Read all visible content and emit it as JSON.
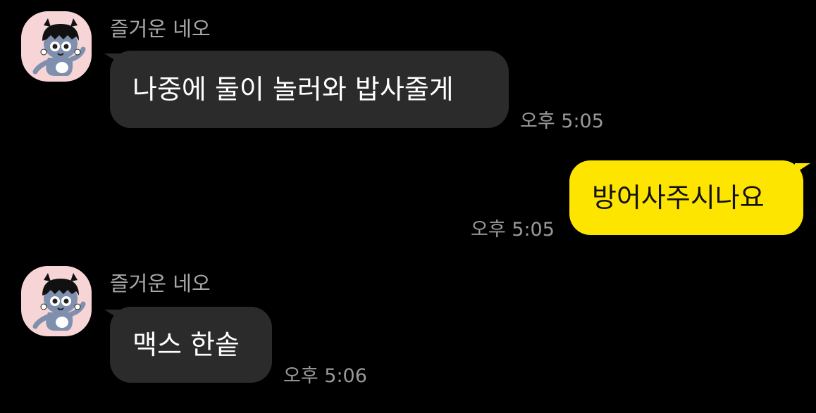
{
  "chat": {
    "messages": [
      {
        "sender": "즐거운 네오",
        "text": "나중에 둘이 놀러와 밥사줄게",
        "time": "오후 5:05",
        "direction": "incoming"
      },
      {
        "text": "방어사주시나요",
        "time": "오후 5:05",
        "direction": "outgoing"
      },
      {
        "sender": "즐거운 네오",
        "text": "맥스 한솥",
        "time": "오후 5:06",
        "direction": "incoming"
      }
    ],
    "avatar_icon": "neo-character-icon"
  },
  "colors": {
    "background": "#000000",
    "incoming_bubble": "#2b2b2b",
    "outgoing_bubble": "#fee500",
    "avatar_background": "#f7d5d6",
    "sender_text": "#a8a8a8",
    "time_text": "#9a9a9a"
  }
}
